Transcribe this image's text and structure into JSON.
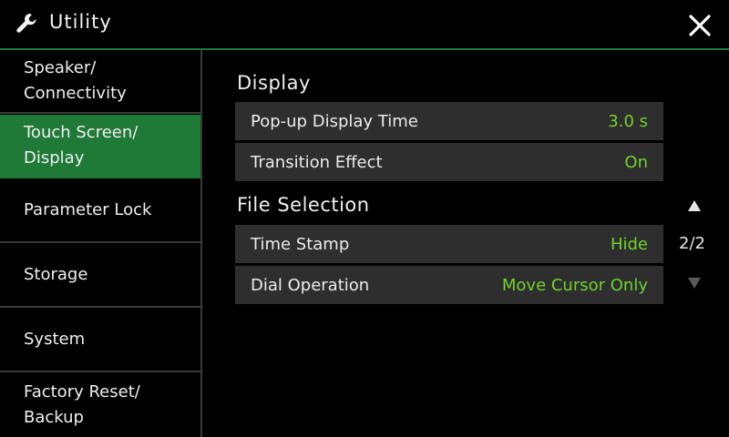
{
  "header": {
    "title": "Utility",
    "icons": {
      "app": "wrench-icon",
      "close": "close-icon"
    }
  },
  "sidebar": {
    "items": [
      {
        "label": "Speaker/\nConnectivity",
        "active": false
      },
      {
        "label": "Touch Screen/\nDisplay",
        "active": true
      },
      {
        "label": "Parameter Lock",
        "active": false
      },
      {
        "label": "Storage",
        "active": false
      },
      {
        "label": "System",
        "active": false
      },
      {
        "label": "Factory Reset/\nBackup",
        "active": false
      }
    ]
  },
  "main": {
    "sections": [
      {
        "title": "Display",
        "rows": [
          {
            "label": "Pop-up Display Time",
            "value": "3.0 s"
          },
          {
            "label": "Transition Effect",
            "value": "On"
          }
        ]
      },
      {
        "title": "File Selection",
        "rows": [
          {
            "label": "Time Stamp",
            "value": "Hide"
          },
          {
            "label": "Dial Operation",
            "value": "Move Cursor Only"
          }
        ]
      }
    ]
  },
  "pager": {
    "text": "2/2",
    "up_icon": "triangle-up-icon",
    "down_icon": "triangle-down-icon"
  },
  "colors": {
    "accent": "#1f7a37",
    "value": "#6fd22e",
    "row_bg": "#2e2e2e",
    "background": "#000000"
  }
}
